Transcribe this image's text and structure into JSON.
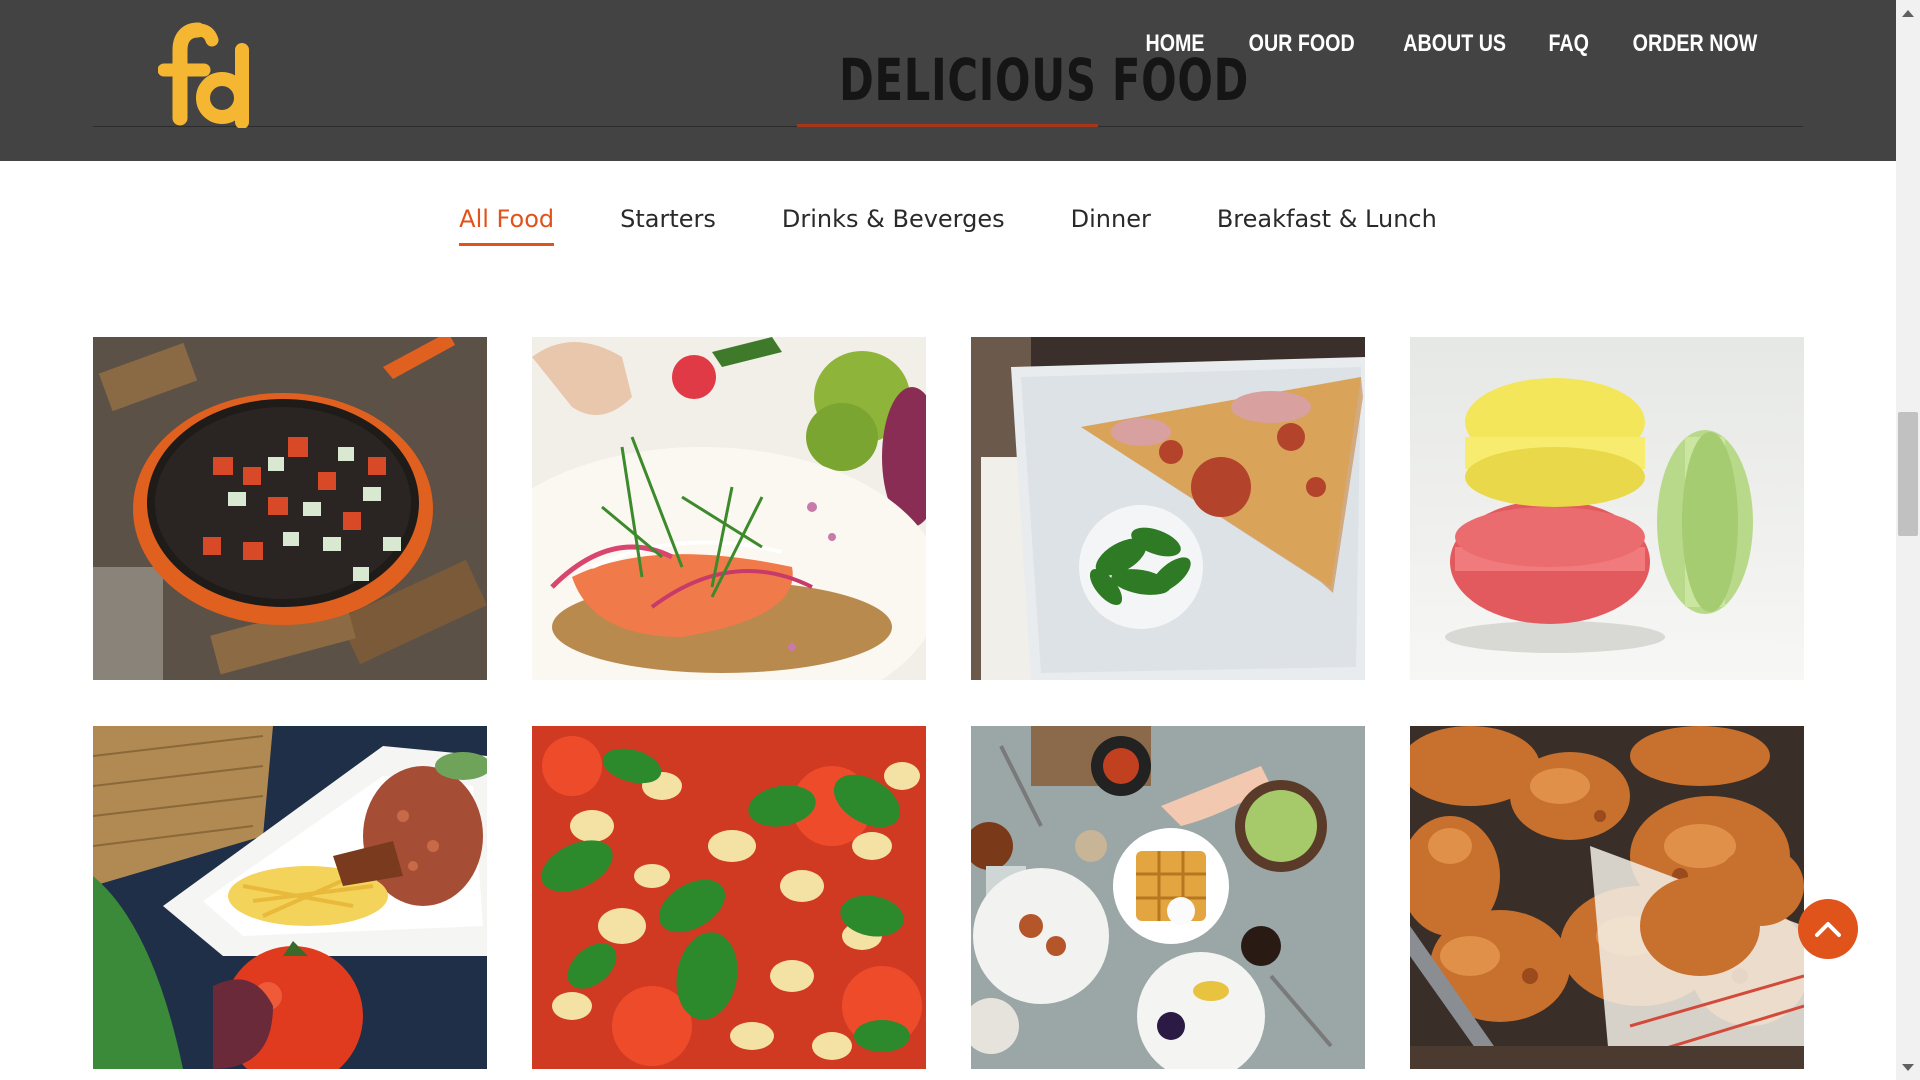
{
  "brand": {
    "logo_text": "fd",
    "title": "DELICIOUS FOOD",
    "logo_color": "#f5b731"
  },
  "nav": {
    "items": [
      "HOME",
      "OUR FOOD",
      "ABOUT US",
      "FAQ",
      "ORDER NOW"
    ]
  },
  "filters": {
    "items": [
      "All Food",
      "Starters",
      "Drinks & Beverges",
      "Dinner",
      "Breakfast & Lunch"
    ],
    "active": "All Food"
  },
  "gallery": {
    "photos": [
      "vegetable-skillet-photo",
      "salmon-toast-photo",
      "pizza-slice-photo",
      "macarons-photo",
      "rice-plate-photo",
      "basil-pizza-photo",
      "breakfast-table-photo",
      "fried-chicken-photo"
    ]
  },
  "colors": {
    "header_bg": "#434343",
    "accent": "#e0531b",
    "title_underline": "#a5361a"
  },
  "icons": {
    "scroll_top": "chevron-up-icon"
  }
}
